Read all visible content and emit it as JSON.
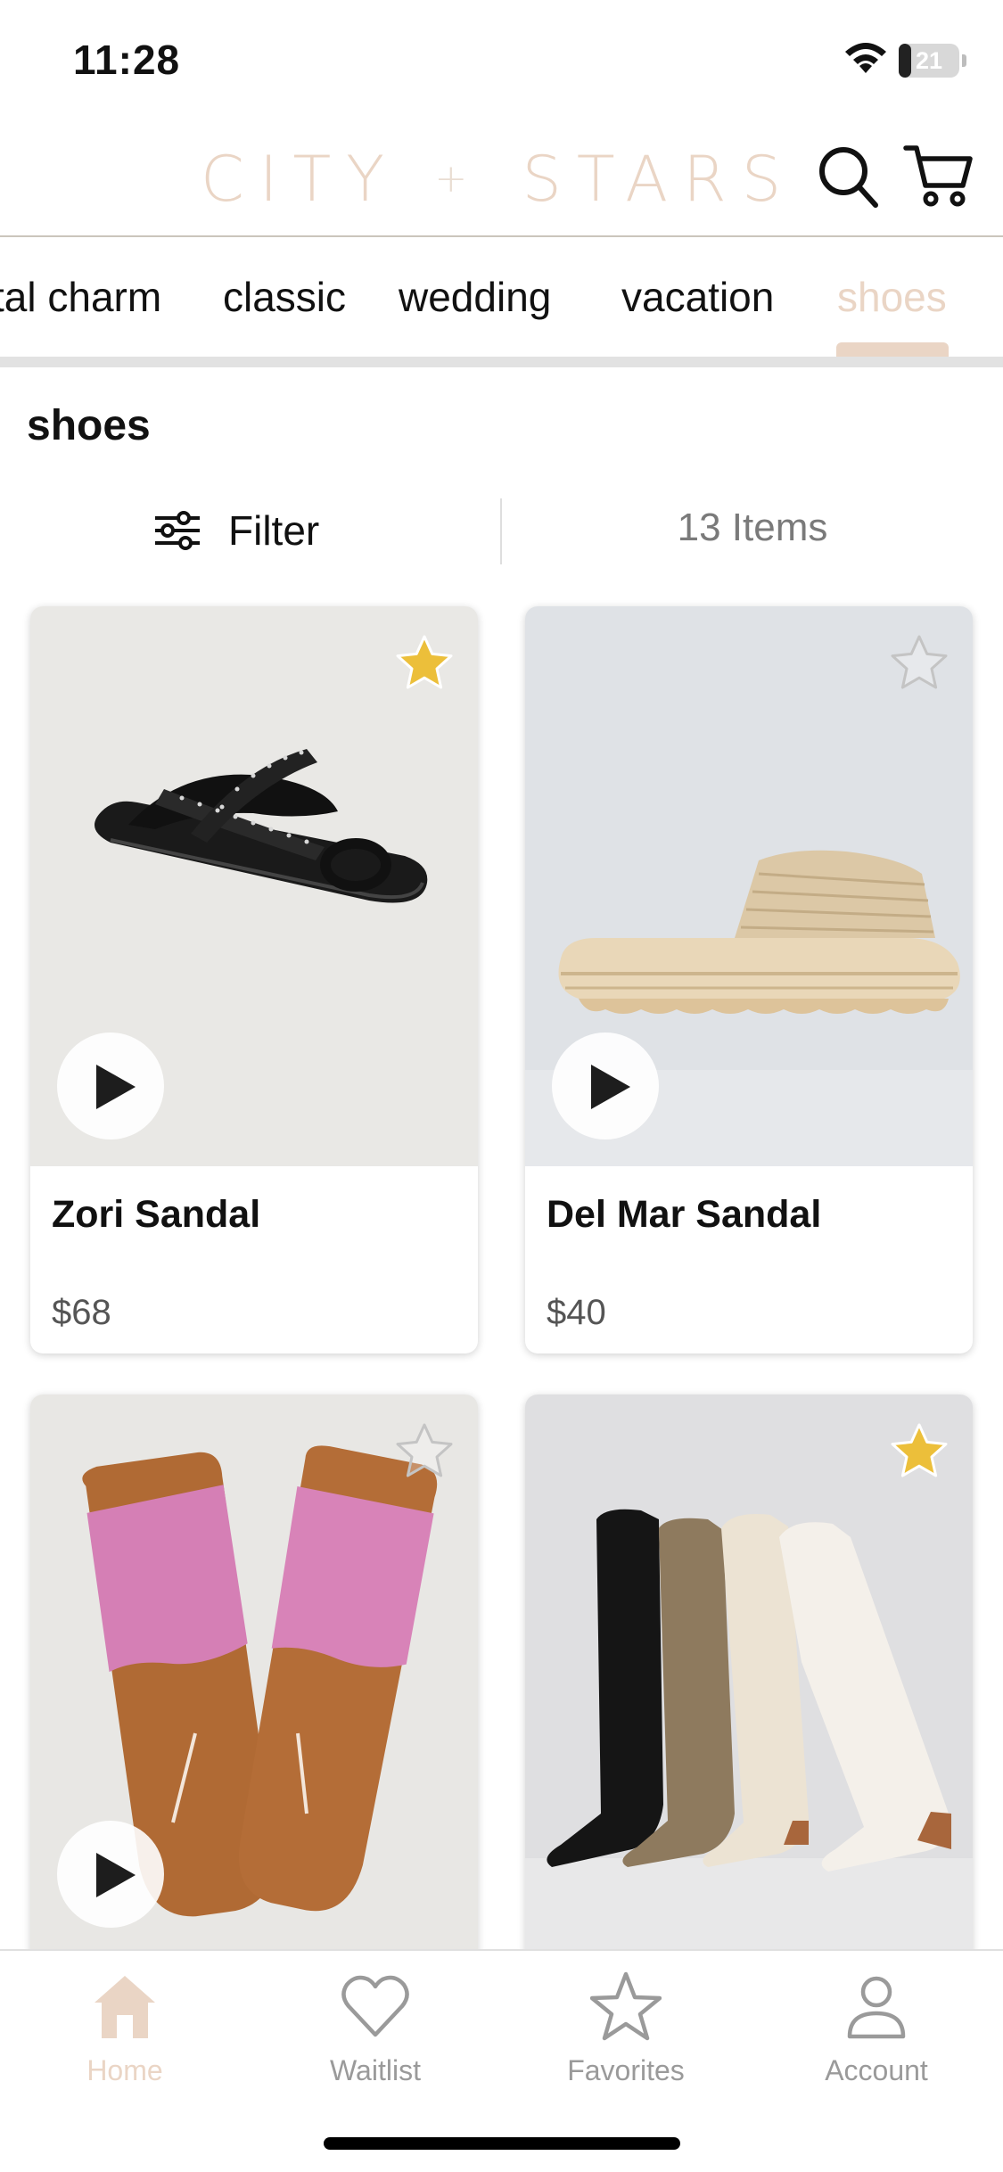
{
  "status_bar": {
    "time": "11:28",
    "battery_level": "21"
  },
  "header": {
    "logo_word1": "CITY",
    "logo_plus": "+",
    "logo_word2": "STARS"
  },
  "tabs": [
    {
      "label": "tal charm",
      "active": false
    },
    {
      "label": "classic",
      "active": false
    },
    {
      "label": "wedding",
      "active": false
    },
    {
      "label": "vacation",
      "active": false
    },
    {
      "label": "shoes",
      "active": true
    }
  ],
  "section": {
    "title": "shoes"
  },
  "filter": {
    "label": "Filter",
    "items_count": "13 Items"
  },
  "products": [
    {
      "name": "Zori Sandal",
      "price": "$68",
      "favorited": true,
      "has_video": true
    },
    {
      "name": "Del Mar Sandal",
      "price": "$40",
      "favorited": false,
      "has_video": true
    },
    {
      "name": "",
      "price": "",
      "favorited": false,
      "has_video": true
    },
    {
      "name": "",
      "price": "",
      "favorited": true,
      "has_video": false
    }
  ],
  "bottom_nav": [
    {
      "label": "Home",
      "icon": "home-icon",
      "active": true
    },
    {
      "label": "Waitlist",
      "icon": "heart-icon",
      "active": false
    },
    {
      "label": "Favorites",
      "icon": "star-icon",
      "active": false
    },
    {
      "label": "Account",
      "icon": "person-icon",
      "active": false
    }
  ],
  "colors": {
    "accent": "#ead5c5",
    "star_active": "#ecbf3a",
    "star_inactive": "#c4c4c4"
  }
}
